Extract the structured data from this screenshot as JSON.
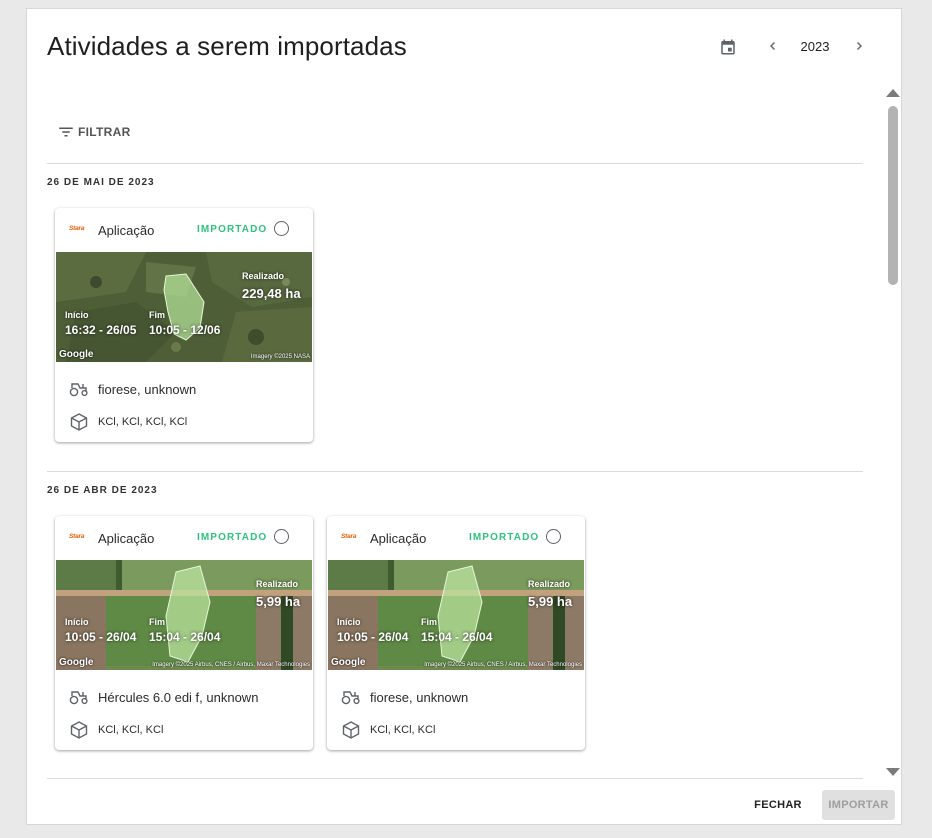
{
  "dialog": {
    "title": "Atividades a serem importadas",
    "year": "2023"
  },
  "toolbar": {
    "filter_label": "FILTRAR"
  },
  "groups": [
    {
      "date": "26 DE MAI DE 2023",
      "cards": [
        {
          "brand": "Stara",
          "type": "Aplicação",
          "status": "IMPORTADO",
          "selected": false,
          "realizado_label": "Realizado",
          "area": "229,48 ha",
          "start_label": "Início",
          "start": "16:32 - 26/05",
          "end_label": "Fim",
          "end": "10:05 - 12/06",
          "map_provider": "Google",
          "imagery_credit": "Imagery ©2025 NASA",
          "machine": "fiorese, unknown",
          "products": "KCl, KCl, KCl, KCl"
        }
      ]
    },
    {
      "date": "26 DE ABR DE 2023",
      "cards": [
        {
          "brand": "Stara",
          "type": "Aplicação",
          "status": "IMPORTADO",
          "selected": false,
          "realizado_label": "Realizado",
          "area": "5,99 ha",
          "start_label": "Início",
          "start": "10:05 - 26/04",
          "end_label": "Fim",
          "end": "15:04 - 26/04",
          "map_provider": "Google",
          "imagery_credit": "Imagery ©2025 Airbus, CNES / Airbus, Maxar Technologies",
          "machine": "Hércules 6.0 edi f, unknown",
          "products": "KCl, KCl, KCl"
        },
        {
          "brand": "Stara",
          "type": "Aplicação",
          "status": "IMPORTADO",
          "selected": false,
          "realizado_label": "Realizado",
          "area": "5,99 ha",
          "start_label": "Início",
          "start": "10:05 - 26/04",
          "end_label": "Fim",
          "end": "15:04 - 26/04",
          "map_provider": "Google",
          "imagery_credit": "Imagery ©2025 Airbus, CNES / Airbus, Maxar Technologies",
          "machine": "fiorese, unknown",
          "products": "KCl, KCl, KCl"
        }
      ]
    }
  ],
  "footer": {
    "close_label": "FECHAR",
    "import_label": "IMPORTAR"
  },
  "colors": {
    "status_imported": "#2ec27e",
    "brand": "#e85d0c",
    "field_polygon": "#b6e39a"
  },
  "icons": {
    "calendar": "calendar-icon",
    "prev": "chevron-left-icon",
    "next": "chevron-right-icon",
    "filter": "filter-icon",
    "machine": "tractor-icon",
    "product": "box-icon"
  }
}
